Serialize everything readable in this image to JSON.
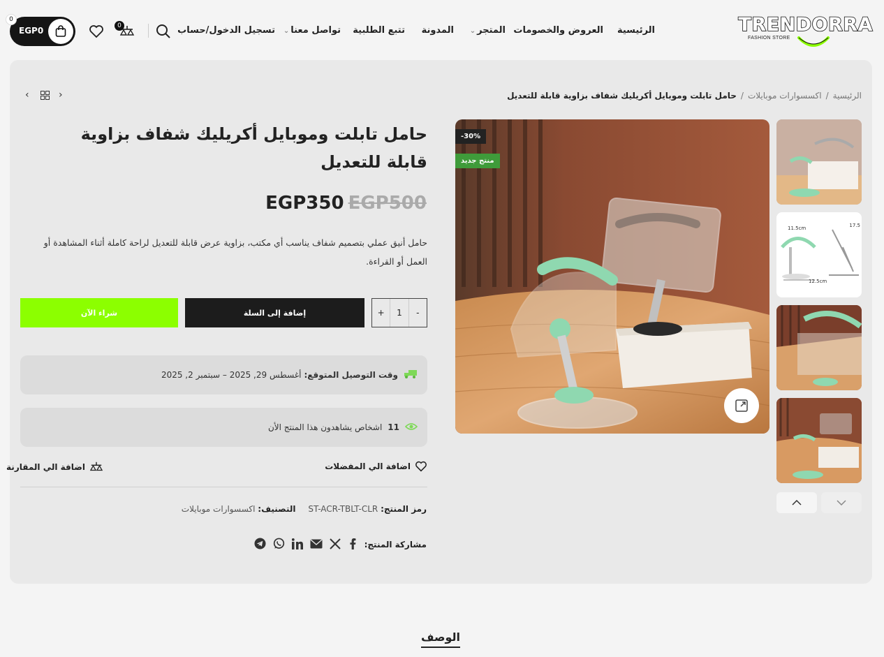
{
  "brand": {
    "name": "TRENDORRA",
    "tagline": "FASHION STORE"
  },
  "nav": {
    "items": [
      "الرئيسية",
      "العروض والخصومات",
      "المتجر",
      "المدونة",
      "تتبع الطلبية",
      "تواصل معنا",
      "تسجيل الدخول/حساب"
    ]
  },
  "header": {
    "compare_count": "0",
    "cart_total": "EGP0",
    "cart_count": "0"
  },
  "breadcrumb": {
    "home": "الرئيسية",
    "category": "اكسسوارات موبايلات",
    "current": "حامل تابلت وموبايل أكريليك شفاف بزاوية قابلة للتعديل"
  },
  "product": {
    "title": "حامل تابلت وموبايل أكريليك شفاف بزاوية قابلة للتعديل",
    "price_new": "EGP350",
    "price_old": "EGP500",
    "description": "حامل أنيق عملي بتصميم شفاف يناسب أي مكتب، بزاوية عرض قابلة للتعديل لراحة كاملة أثناء المشاهدة أو العمل أو القراءة.",
    "qty_plus": "+",
    "qty_value": "1",
    "qty_minus": "-",
    "add_to_cart": "إضافة إلى السلة",
    "buy_now": "شراء الآن",
    "delivery_label": "وقت التوصيل المتوقع:",
    "delivery_value": "أغسطس 29, 2025 – سبتمبر 2, 2025",
    "viewers_count": "11",
    "viewers_text": "اشخاص يشاهدون هذا المنتج الأن",
    "wishlist": "اضافة الي المفضلات",
    "compare": "اضافة الي المقارنة",
    "sku_label": "رمز المنتج:",
    "sku_value": "ST-ACR-TBLT-CLR",
    "category_label": "التصنيف:",
    "category_value": "اكسسوارات موبايلات",
    "share_label": "مشاركة المنتج:",
    "badge_discount": "-30%",
    "badge_new": "منتج جديد"
  },
  "gallery": {
    "dim_1": "11.5cm",
    "dim_2": "17.5",
    "dim_3": "12.5cm"
  },
  "tabs": {
    "description": "الوصف"
  },
  "colors": {
    "accent_green": "#8cff00",
    "dark": "#1c1c1c",
    "new_badge": "#3f9b3a"
  }
}
